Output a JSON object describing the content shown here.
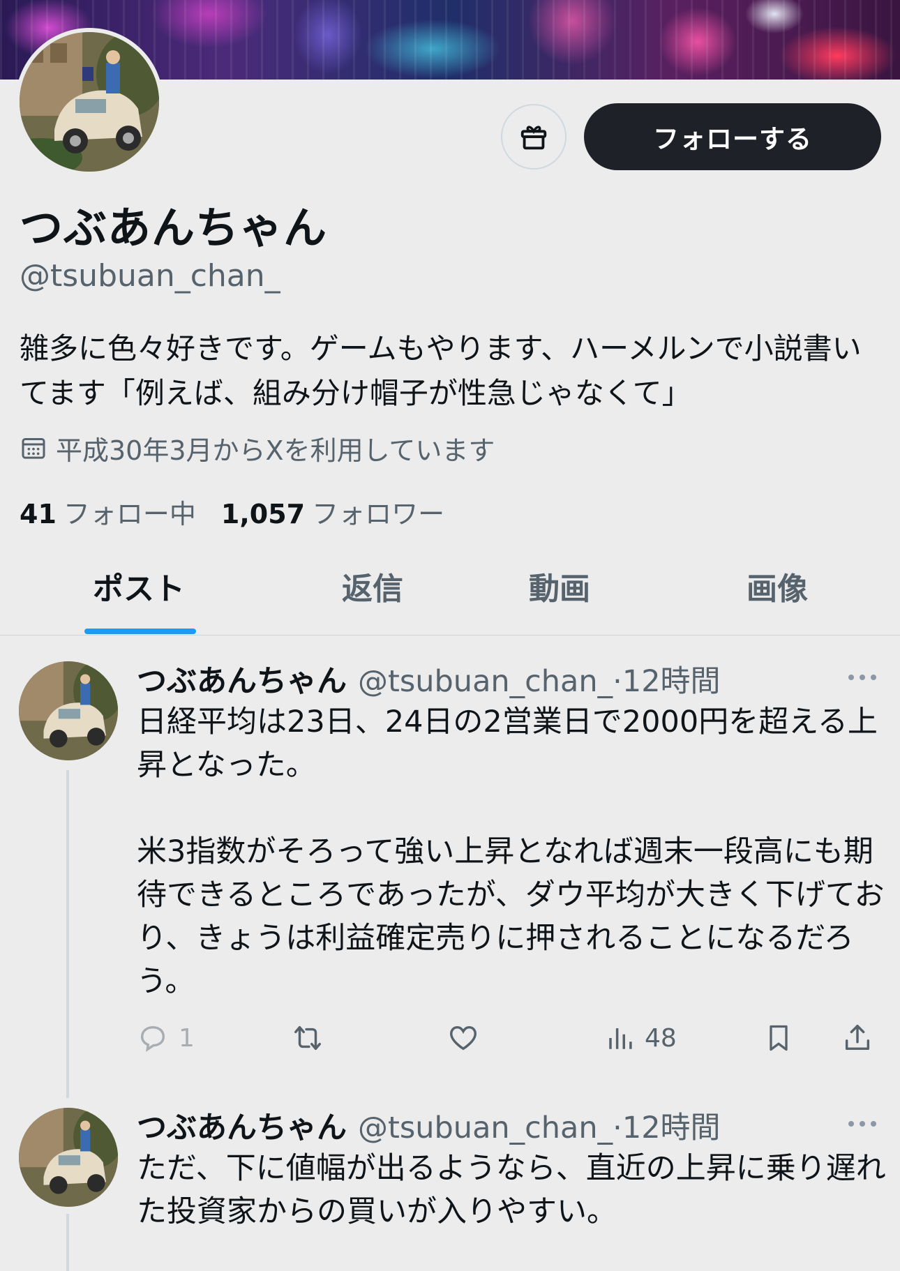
{
  "profile": {
    "display_name": "つぶあんちゃん",
    "handle": "@tsubuan_chan_",
    "bio": "雑多に色々好きです。ゲームもやります、ハーメルンで小説書いてます「例えば、組み分け帽子が性急じゃなくて」",
    "joined": "平成30年3月からXを利用しています",
    "following_count": "41",
    "following_label": "フォロー中",
    "followers_count": "1,057",
    "followers_label": "フォロワー"
  },
  "buttons": {
    "follow_label": "フォローする"
  },
  "tabs": [
    {
      "label": "ポスト"
    },
    {
      "label": "返信"
    },
    {
      "label": "動画"
    },
    {
      "label": "画像"
    }
  ],
  "posts": [
    {
      "author": "つぶあんちゃん",
      "handle": "@tsubuan_chan_",
      "time": "·12時間",
      "text": "日経平均は23日、24日の2営業日で2000円を超える上昇となった。\n\n米3指数がそろって強い上昇となれば週末一段高にも期待できるところであったが、ダウ平均が大きく下げており、きょうは利益確定売りに押されることになるだろう。",
      "replies": "1",
      "views": "48"
    },
    {
      "author": "つぶあんちゃん",
      "handle": "@tsubuan_chan_",
      "time": "·12時間",
      "text": "ただ、下に値幅が出るようなら、直近の上昇に乗り遅れた投資家からの買いが入りやすい。"
    }
  ],
  "colors": {
    "background": "#ececec",
    "follow_button": "#1e2228",
    "accent": "#1d9bf0",
    "secondary_text": "#56626c"
  }
}
